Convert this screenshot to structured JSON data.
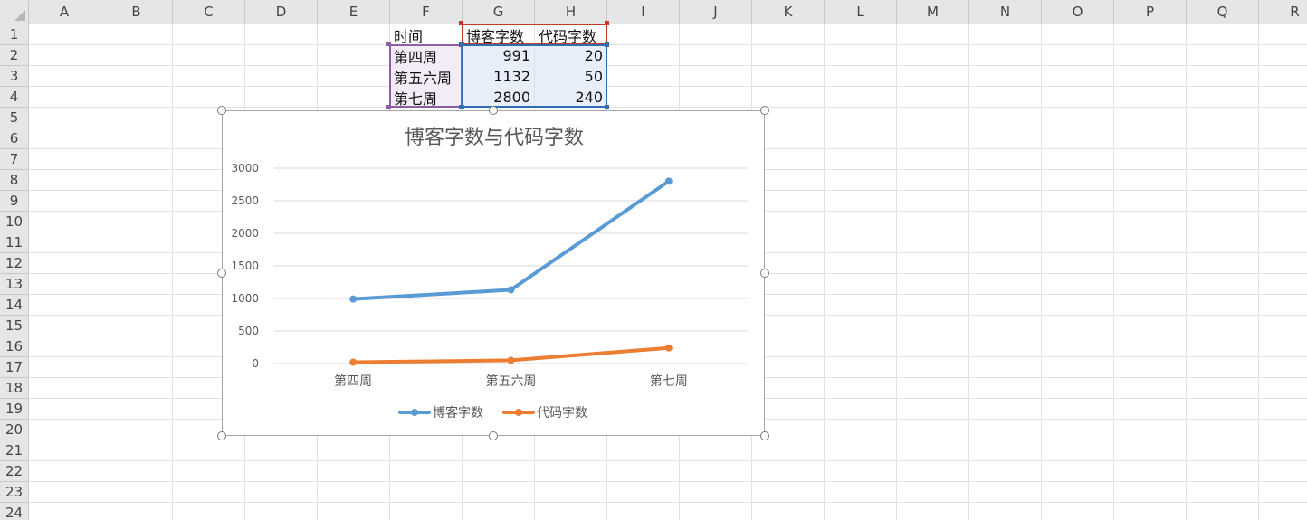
{
  "sheet": {
    "columns": [
      "A",
      "B",
      "C",
      "D",
      "E",
      "F",
      "G",
      "H",
      "I",
      "J",
      "K",
      "L",
      "M",
      "N",
      "O",
      "P",
      "Q",
      "R"
    ],
    "rows": [
      "1",
      "2",
      "3",
      "4",
      "5",
      "6",
      "7",
      "8",
      "9",
      "10",
      "11",
      "12",
      "13",
      "14",
      "15",
      "16",
      "17",
      "18",
      "19",
      "20",
      "21",
      "22",
      "23",
      "24"
    ],
    "table": {
      "header": [
        "时间",
        "博客字数",
        "代码字数"
      ],
      "rows": [
        [
          "第四周",
          "991",
          "20"
        ],
        [
          "第五六周",
          "1132",
          "50"
        ],
        [
          "第七周",
          "2800",
          "240"
        ]
      ]
    }
  },
  "colors": {
    "series_blog": "#5b9bd5",
    "series_code": "#ed7d31",
    "ref_purple": "#8e5ea2",
    "ref_red": "#c0392b",
    "ref_blue": "#2f6db5"
  },
  "chart_data": {
    "type": "line",
    "title": "博客字数与代码字数",
    "categories": [
      "第四周",
      "第五六周",
      "第七周"
    ],
    "series": [
      {
        "name": "博客字数",
        "values": [
          991,
          1132,
          2800
        ],
        "color": "#5b9bd5"
      },
      {
        "name": "代码字数",
        "values": [
          20,
          50,
          240
        ],
        "color": "#ed7d31"
      }
    ],
    "ylim": [
      0,
      3000
    ],
    "yticks": [
      0,
      500,
      1000,
      1500,
      2000,
      2500,
      3000
    ],
    "grid": true,
    "legend": "bottom"
  }
}
